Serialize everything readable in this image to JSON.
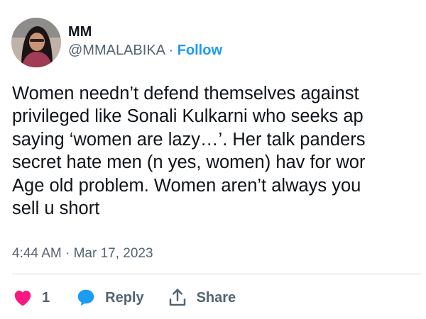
{
  "user": {
    "display_name": "MM",
    "handle": "@MMALABIKA",
    "separator": " · ",
    "follow_label": "Follow"
  },
  "tweet": {
    "lines": [
      "Women needn’t defend themselves against",
      "privileged like Sonali Kulkarni who seeks ap",
      "saying ‘women are lazy…’. Her talk panders",
      "secret hate men (n yes, women) hav for wor",
      "Age old problem. Women aren’t always you",
      "sell u short"
    ],
    "timestamp": "4:44 AM · Mar 17, 2023"
  },
  "actions": {
    "like_count": "1",
    "reply_label": "Reply",
    "share_label": "Share"
  },
  "colors": {
    "accent": "#1d9bf0",
    "like": "#f91880",
    "text": "#0f1419",
    "secondary": "#536471",
    "divider": "#cfd9de"
  },
  "icons": {
    "like": "heart-icon",
    "reply": "speech-bubble-icon",
    "share": "upload-share-icon"
  }
}
